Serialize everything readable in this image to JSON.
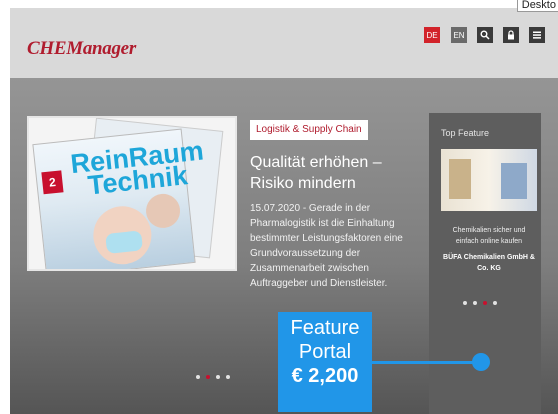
{
  "corner_label": "Deskto",
  "header": {
    "logo": "CHEManager",
    "lang_de": "DE",
    "lang_en": "EN"
  },
  "article": {
    "category": "Logistik & Supply Chain",
    "title": "Qualität erhöhen – Risiko mindern",
    "teaser": "15.07.2020 - Gerade in der Pharmalogistik ist die Einhaltung bestimmter Leistungsfaktoren eine Grundvoraussetzung der Zusammenarbeit zwischen Auftraggeber und Dienstleister.",
    "magazine": {
      "number": "2",
      "title_line1": "ReinRaum",
      "title_line2": "Technik"
    }
  },
  "top_feature": {
    "label": "Top Feature",
    "text": "Chemikalien sicher und einfach online kaufen",
    "company": "BÜFA Chemikalien GmbH & Co. KG"
  },
  "carousel": {
    "main_dots": 4,
    "main_active": 1,
    "side_dots": 4,
    "side_active": 2
  },
  "promo": {
    "line1": "Feature",
    "line2": "Portal",
    "price": "€ 2,200"
  },
  "colors": {
    "brand_red": "#b01c2e",
    "promo_blue": "#2196e8"
  },
  "icons": [
    "search-icon",
    "lock-icon",
    "menu-icon"
  ]
}
